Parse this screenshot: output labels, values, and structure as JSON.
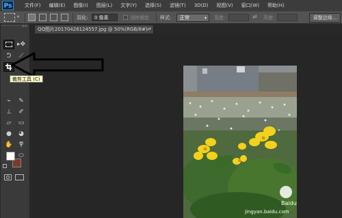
{
  "app": {
    "logo": "Ps"
  },
  "menu": [
    "文件(F)",
    "编辑(E)",
    "图像(I)",
    "图层(L)",
    "文字(Y)",
    "选择(S)",
    "滤镜(T)",
    "3D(D)",
    "视图(V)",
    "窗口(W)",
    "帮助(H)"
  ],
  "options": {
    "feather_label": "羽化:",
    "feather_value": "0 像素",
    "antialias_label": "消除锯齿",
    "style_label": "样式:",
    "style_value": "正常",
    "width_label": "宽度:",
    "height_label": "高度:",
    "refine_edge_button": "调整边缘..."
  },
  "document": {
    "tab_title": "QQ图片20170426124557.jpg @ 50%(RGB/8#) *",
    "close_glyph": "×"
  },
  "tooltip": {
    "text": "裁剪工具 (C)"
  },
  "colors": {
    "foreground": "#ffffff",
    "background": "#7a3b2a",
    "tooltip_bg": "#fbf7c5",
    "accent_logo": "#2f8fd8"
  },
  "watermark": {
    "brand": "Baidu 经验",
    "url": "jingyan.baidu.com"
  }
}
